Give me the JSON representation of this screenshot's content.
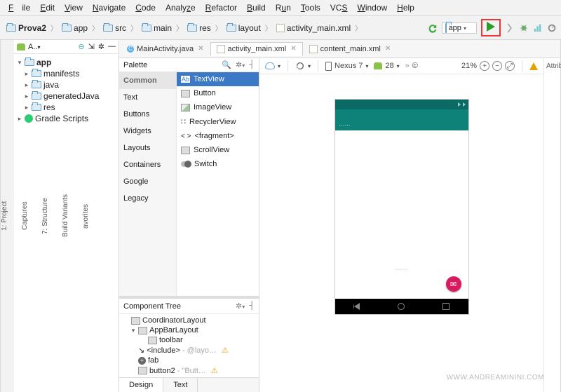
{
  "menu": [
    "File",
    "Edit",
    "View",
    "Navigate",
    "Code",
    "Analyze",
    "Refactor",
    "Build",
    "Run",
    "Tools",
    "VCS",
    "Window",
    "Help"
  ],
  "breadcrumbs": [
    "Prova2",
    "app",
    "src",
    "main",
    "res",
    "layout",
    "activity_main.xml"
  ],
  "run": {
    "config": "app"
  },
  "side_left": [
    "1: Project",
    "Captures",
    "7: Structure",
    "Build Variants",
    "avorites"
  ],
  "project": {
    "mode": "Android",
    "root": "app",
    "nodes": [
      "manifests",
      "java",
      "generatedJava",
      "res"
    ],
    "gradle": "Gradle Scripts"
  },
  "tabs": [
    {
      "label": "MainActivity.java",
      "kind": "java"
    },
    {
      "label": "activity_main.xml",
      "kind": "xml",
      "active": true
    },
    {
      "label": "content_main.xml",
      "kind": "xml"
    }
  ],
  "palette": {
    "title": "Palette",
    "categories": [
      "Common",
      "Text",
      "Buttons",
      "Widgets",
      "Layouts",
      "Containers",
      "Google",
      "Legacy"
    ],
    "selected_cat": "Common",
    "items": [
      "TextView",
      "Button",
      "ImageView",
      "RecyclerView",
      "<fragment>",
      "ScrollView",
      "Switch"
    ],
    "selected_item": "TextView"
  },
  "component_tree": {
    "title": "Component Tree",
    "rows": [
      {
        "label": "CoordinatorLayout",
        "icon": "layout",
        "depth": 0,
        "caret": "none"
      },
      {
        "label": "AppBarLayout",
        "icon": "layout",
        "depth": 1,
        "caret": "open"
      },
      {
        "label": "toolbar",
        "icon": "bar",
        "depth": 2,
        "caret": "none"
      },
      {
        "label": "<include>",
        "hint": " - @layo…",
        "icon": "include",
        "depth": 1,
        "caret": "leaf",
        "warn": true
      },
      {
        "label": "fab",
        "icon": "fab",
        "depth": 1,
        "caret": "leaf"
      },
      {
        "label": "button2",
        "hint": " - \"Butt…",
        "icon": "button",
        "depth": 1,
        "caret": "leaf",
        "warn": true
      }
    ]
  },
  "design_tabs": [
    "Design",
    "Text"
  ],
  "canvas_toolbar": {
    "device": "Nexus 7",
    "api": "28",
    "zoom": "21%"
  },
  "device_preview": {
    "title_hint": "······",
    "content_hint": "········",
    "fab_glyph": "✉"
  },
  "attributes_tab": "Attribute",
  "watermark": "WWW.ANDREAMININI.COM"
}
